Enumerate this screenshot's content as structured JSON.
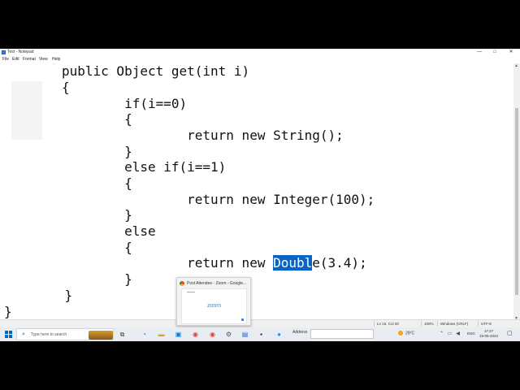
{
  "window": {
    "title": "Test - Notepad",
    "controls": {
      "minimize": "—",
      "maximize": "□",
      "close": "✕"
    }
  },
  "menu": [
    "File",
    "Edit",
    "Format",
    "View",
    "Help"
  ],
  "code": {
    "lines": [
      "public Object get(int i)",
      "{",
      "        if(i==0)",
      "        {",
      "                return new String();",
      "        }",
      "        else if(i==1)",
      "        {",
      "                return new Integer(100);",
      "        }",
      "        else",
      "        {",
      "                return new ",
      "        }",
      "    }",
      "}"
    ],
    "selected_line": {
      "before": "                return new ",
      "selected": "Doubl",
      "after": "e(3.4);"
    }
  },
  "status": {
    "position": "Ln 15, Col 20",
    "zoom": "100%",
    "line_ending": "Windows (CRLF)",
    "encoding": "UTF-8"
  },
  "thumbnail": {
    "title": "Post Attendee - Zoom - Google...",
    "content": "zoom"
  },
  "taskbar": {
    "search_placeholder": "Type here to search",
    "address_label": "Address",
    "weather": "29°C",
    "language": "ENG",
    "time": "17:27",
    "date": "19-05-2023"
  },
  "colors": {
    "selection": "#0a64c8",
    "zoom_brand": "#2d8cff",
    "start_blue": "#0067c0"
  }
}
